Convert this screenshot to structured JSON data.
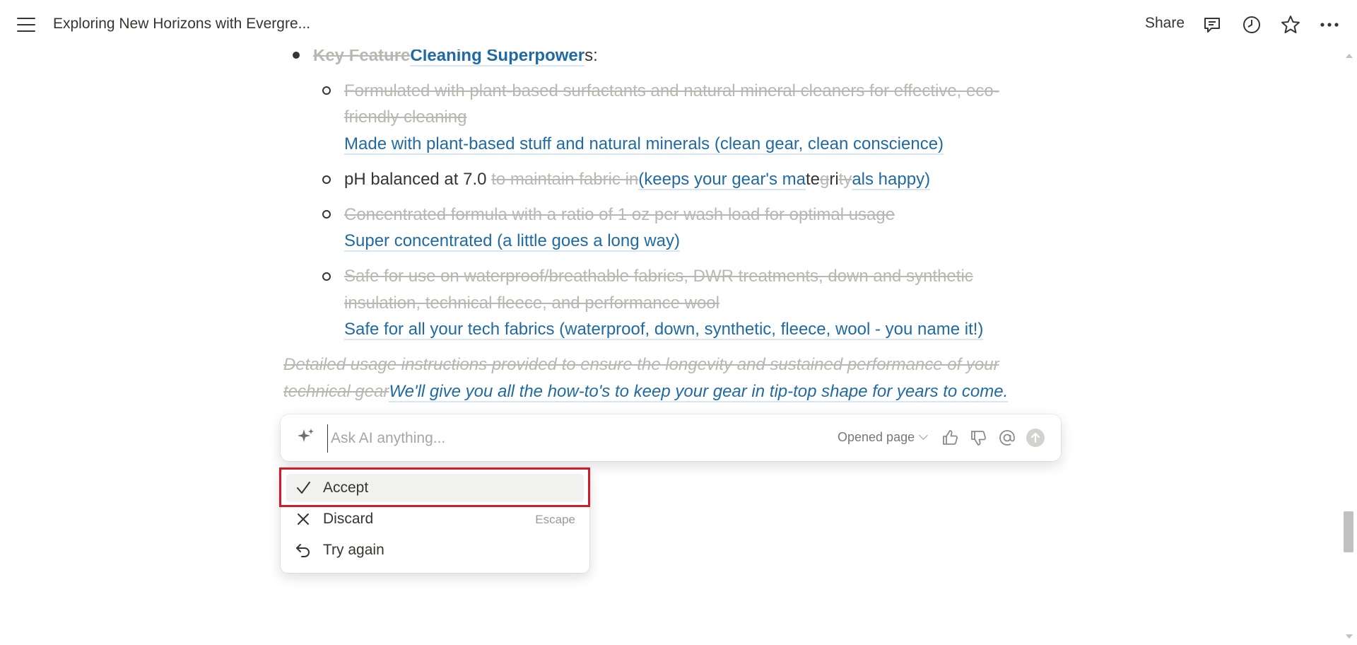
{
  "header": {
    "title": "Exploring New Horizons with Evergre...",
    "share_label": "Share",
    "icons": [
      "menu-icon",
      "comment-icon",
      "clock-icon",
      "star-icon",
      "more-icon"
    ]
  },
  "document": {
    "feature_heading": {
      "deleted": "Key Feature",
      "inserted": "Cleaning Superpower",
      "suffix": "s:"
    },
    "items": [
      {
        "deleted_line1": "Formulated with plant-based surfactants and natural mineral cleaners for effective, eco-",
        "deleted_line2": "friendly cleaning",
        "inserted": "Made with plant-based stuff and natural minerals (clean gear, clean conscience)"
      },
      {
        "plain": "pH balanced at 7.0 ",
        "deleted": "to maintain fabric in",
        "inserted_a": "(keeps your gear's ma",
        "plain_b": "te",
        "deleted_b": "g",
        "plain_c": "ri",
        "deleted_c": "ty",
        "inserted_d": "als happy)"
      },
      {
        "deleted": "Concentrated formula with a ratio of 1 oz per wash load for optimal usage",
        "inserted": "Super concentrated (a little goes a long way)"
      },
      {
        "deleted_line1": "Safe for use on waterproof/breathable fabrics, DWR treatments, down and synthetic",
        "deleted_line2": "insulation, technical fleece, and performance wool",
        "inserted": "Safe for all your tech fabrics (waterproof, down, synthetic, fleece, wool - you name it!)"
      }
    ],
    "closing": {
      "deleted_line1": "Detailed usage instructions provided to ensure the longevity and sustained performance of your",
      "deleted_line2": "technical gear",
      "inserted": "We'll give you all the how-to's to keep your gear in tip-top shape for years to come."
    }
  },
  "ai_bar": {
    "placeholder": "Ask AI anything...",
    "value": "",
    "scope_label": "Opened page",
    "icons": [
      "sparkle-icon",
      "thumbs-up-icon",
      "thumbs-down-icon",
      "at-icon",
      "send-icon"
    ]
  },
  "ai_actions": [
    {
      "label": "Accept",
      "shortcut": "",
      "icon": "check-icon",
      "highlighted": true
    },
    {
      "label": "Discard",
      "shortcut": "Escape",
      "icon": "close-icon",
      "highlighted": false
    },
    {
      "label": "Try again",
      "shortcut": "",
      "icon": "undo-icon",
      "highlighted": false
    }
  ],
  "colors": {
    "inserted_text": "#1f6aa5",
    "deleted_text": "#b9b7b2",
    "focus_ring": "#d11a2a"
  }
}
